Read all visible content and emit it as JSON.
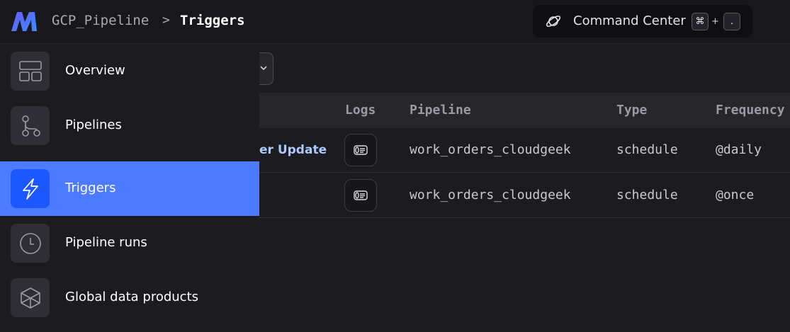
{
  "header": {
    "project": "GCP_Pipeline",
    "separator": ">",
    "page": "Triggers",
    "command_center": {
      "label": "Command Center",
      "key_modifier": "⌘",
      "key_plus": "+",
      "key_char": "."
    }
  },
  "table": {
    "columns": [
      "Logs",
      "Pipeline",
      "Type",
      "Frequency"
    ],
    "rows": [
      {
        "name": "er Update",
        "pipeline": "work_orders_cloudgeek",
        "type": "schedule",
        "frequency": "@daily"
      },
      {
        "name": "",
        "pipeline": "work_orders_cloudgeek",
        "type": "schedule",
        "frequency": "@once"
      }
    ]
  },
  "sidebar": {
    "items": [
      {
        "label": "Overview",
        "icon": "layout-icon",
        "active": false
      },
      {
        "label": "Pipelines",
        "icon": "pipelines-icon",
        "active": false
      },
      {
        "label": "Triggers",
        "icon": "lightning-icon",
        "active": true
      },
      {
        "label": "Pipeline runs",
        "icon": "clock-icon",
        "active": false
      },
      {
        "label": "Global data products",
        "icon": "cube-icon",
        "active": false
      }
    ]
  },
  "colors": {
    "accent": "#4d7bff",
    "accent_dark": "#1c57ff",
    "link": "#a9c9ff",
    "background": "#1c1c20"
  }
}
